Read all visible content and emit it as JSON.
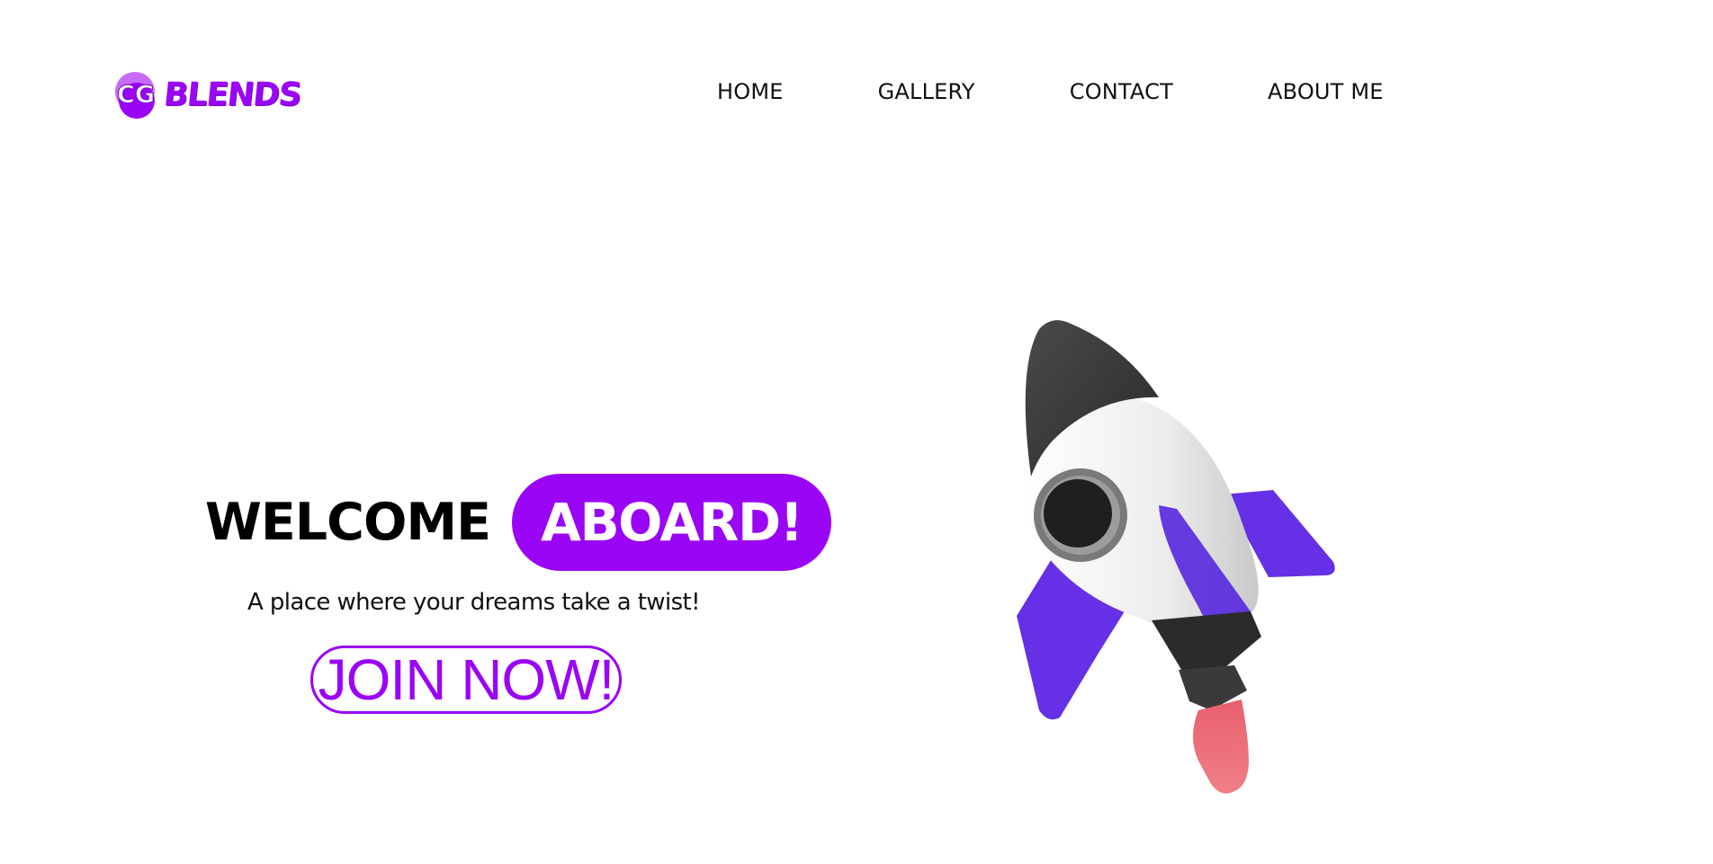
{
  "header": {
    "logo": {
      "badge_text": "CG",
      "word_text": "BLENDS",
      "brand_color": "#9a05f5"
    },
    "nav": [
      {
        "label": "HOME"
      },
      {
        "label": "GALLERY"
      },
      {
        "label": "CONTACT"
      },
      {
        "label": "ABOUT ME"
      }
    ]
  },
  "hero": {
    "welcome": "WELCOME",
    "highlight": "ABOARD!",
    "tagline": "A place where your dreams take a twist!",
    "cta_label": "JOIN NOW!",
    "accent_color": "#9a05f5"
  },
  "illustration": {
    "icon": "rocket-icon",
    "colors": {
      "nose": "#3a3a3a",
      "body": "#ededed",
      "fins": "#6530e6",
      "flame": "#ea6f7a"
    }
  }
}
